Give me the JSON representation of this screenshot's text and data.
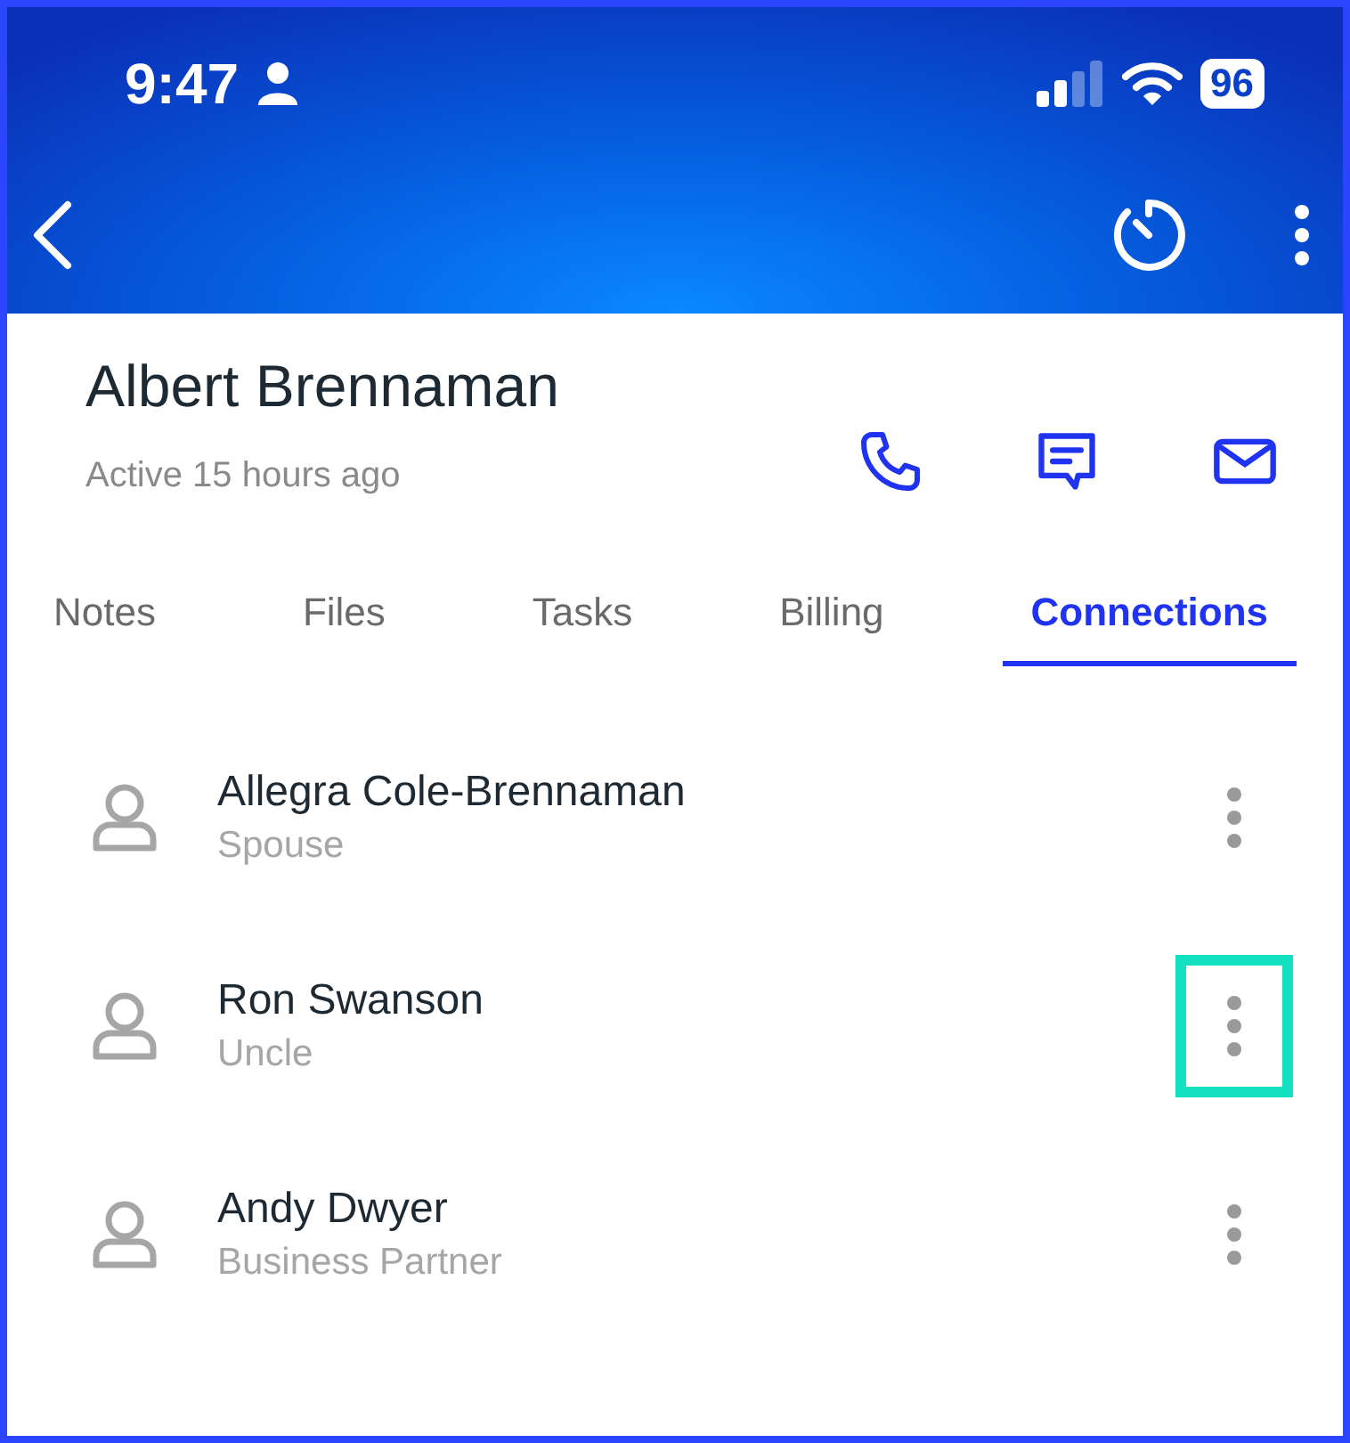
{
  "status_bar": {
    "time": "9:47",
    "battery": "96"
  },
  "contact": {
    "name": "Albert Brennaman",
    "activity": "Active 15 hours ago"
  },
  "tabs": [
    {
      "label": "Notes",
      "selected": false
    },
    {
      "label": "Files",
      "selected": false
    },
    {
      "label": "Tasks",
      "selected": false
    },
    {
      "label": "Billing",
      "selected": false
    },
    {
      "label": "Connections",
      "selected": true
    }
  ],
  "connections": [
    {
      "name": "Allegra Cole-Brennaman",
      "relation": "Spouse",
      "highlighted": false
    },
    {
      "name": "Ron Swanson",
      "relation": "Uncle",
      "highlighted": true
    },
    {
      "name": "Andy Dwyer",
      "relation": "Business Partner",
      "highlighted": false
    }
  ]
}
